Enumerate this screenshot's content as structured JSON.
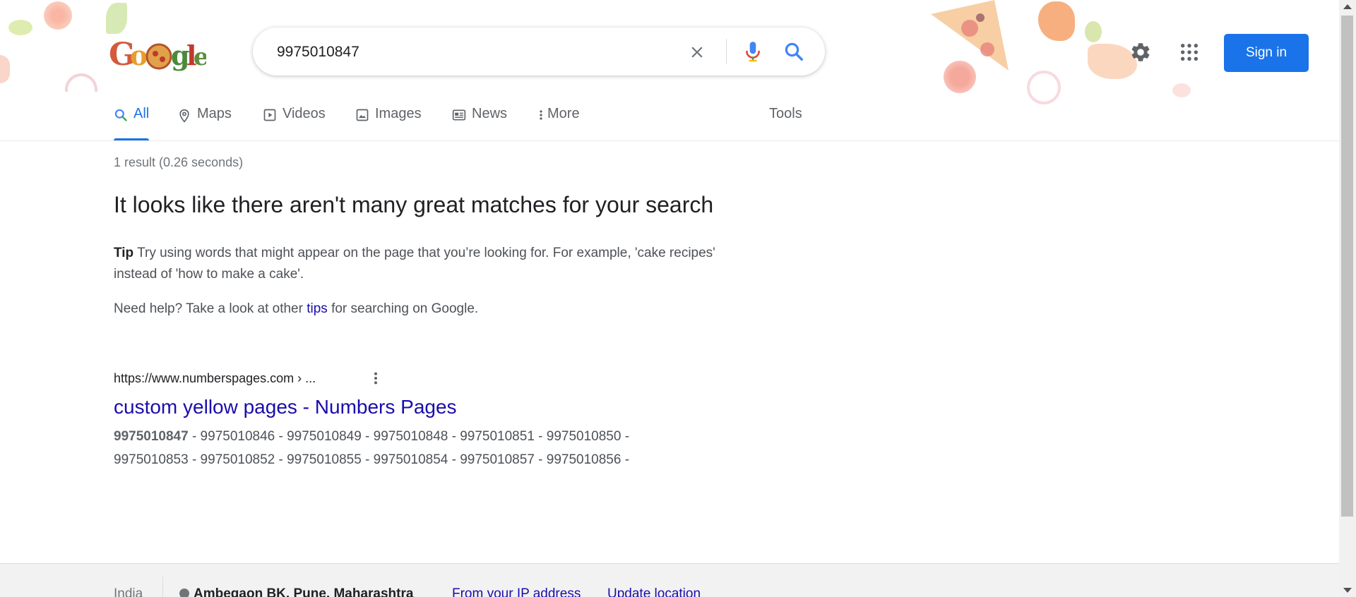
{
  "search": {
    "query": "9975010847",
    "clear_icon": "close-icon",
    "voice_icon": "mic-icon",
    "search_icon": "search-icon"
  },
  "header": {
    "logo_alt": "Google",
    "settings_icon": "gear-icon",
    "apps_icon": "apps-grid-icon",
    "signin_label": "Sign in",
    "accent_color": "#1a73e8"
  },
  "tabs": [
    {
      "label": "All",
      "icon": "search-icon",
      "active": true
    },
    {
      "label": "Maps",
      "icon": "map-pin-icon",
      "active": false
    },
    {
      "label": "Videos",
      "icon": "play-icon",
      "active": false
    },
    {
      "label": "Images",
      "icon": "image-icon",
      "active": false
    },
    {
      "label": "News",
      "icon": "news-icon",
      "active": false
    },
    {
      "label": "More",
      "icon": "more-vert-icon",
      "active": false
    }
  ],
  "tools_label": "Tools",
  "stats": "1 result (0.26 seconds)",
  "notice": {
    "title": "It looks like there aren't many great matches for your search",
    "tip_label": "Tip",
    "tip_text": " Try using words that might appear on the page that you’re looking for. For example, 'cake recipes' instead of 'how to make a cake'.",
    "help_prefix": "Need help? Take a look at other ",
    "help_link": "tips",
    "help_suffix": " for searching on Google."
  },
  "result": {
    "url": "https://www.numberspages.com › ...",
    "title": "custom yellow pages - Numbers Pages",
    "snippet_bold": "9975010847",
    "snippet_rest": " - 9975010846 - 9975010849 - 9975010848 - 9975010851 - 9975010850 - 9975010853 - 9975010852 - 9975010855 - 9975010854 - 9975010857 - 9975010856 -",
    "link_color": "#1a0dab"
  },
  "footer": {
    "country": "India",
    "location": "Ambegaon BK, Pune, Maharashtra",
    "location_source": "From your IP address",
    "update_location": "Update location"
  }
}
